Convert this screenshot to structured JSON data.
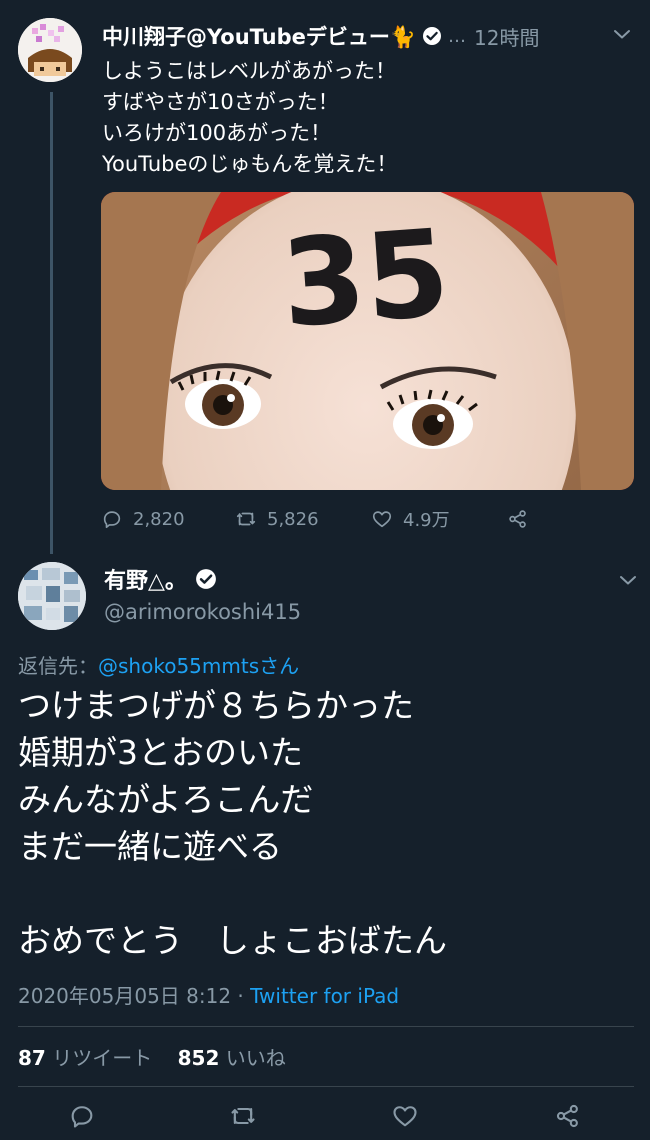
{
  "tweet": {
    "author_name": "中川翔子@YouTubeデビュー🐈",
    "more": "…",
    "time": "12時間",
    "lines": [
      "しようこはレベルがあがった！",
      "すばやさが10さがった！",
      "いろけが100あがった！",
      "YouTubeのじゅもんを覚えた！"
    ],
    "photo_text": "35",
    "reply_count": "2,820",
    "retweet_count": "5,826",
    "like_count": "4.9万"
  },
  "reply": {
    "author_name": "有野△。",
    "handle": "@arimorokoshi415",
    "reply_to_label": "返信先：",
    "reply_to_mention": "@shoko55mmtsさん",
    "lines": [
      "つけまつげが８ちらかった",
      "婚期が3とおのいた",
      "みんながよろこんだ",
      "まだ一緒に遊べる",
      "",
      "おめでとう　しょこおばたん"
    ],
    "timestamp": "2020年05月05日 8:12 · ",
    "source": "Twitter for iPad",
    "retweets_count": "87",
    "retweets_label": "リツイート",
    "likes_count": "852",
    "likes_label": "いいね"
  },
  "colors": {
    "background": "#15202b",
    "accent": "#1da1f2",
    "muted": "#8899a6",
    "divider": "#38444d"
  },
  "icons": [
    "verified-badge-icon",
    "chevron-down-icon",
    "reply-icon",
    "retweet-icon",
    "like-icon",
    "share-icon"
  ]
}
